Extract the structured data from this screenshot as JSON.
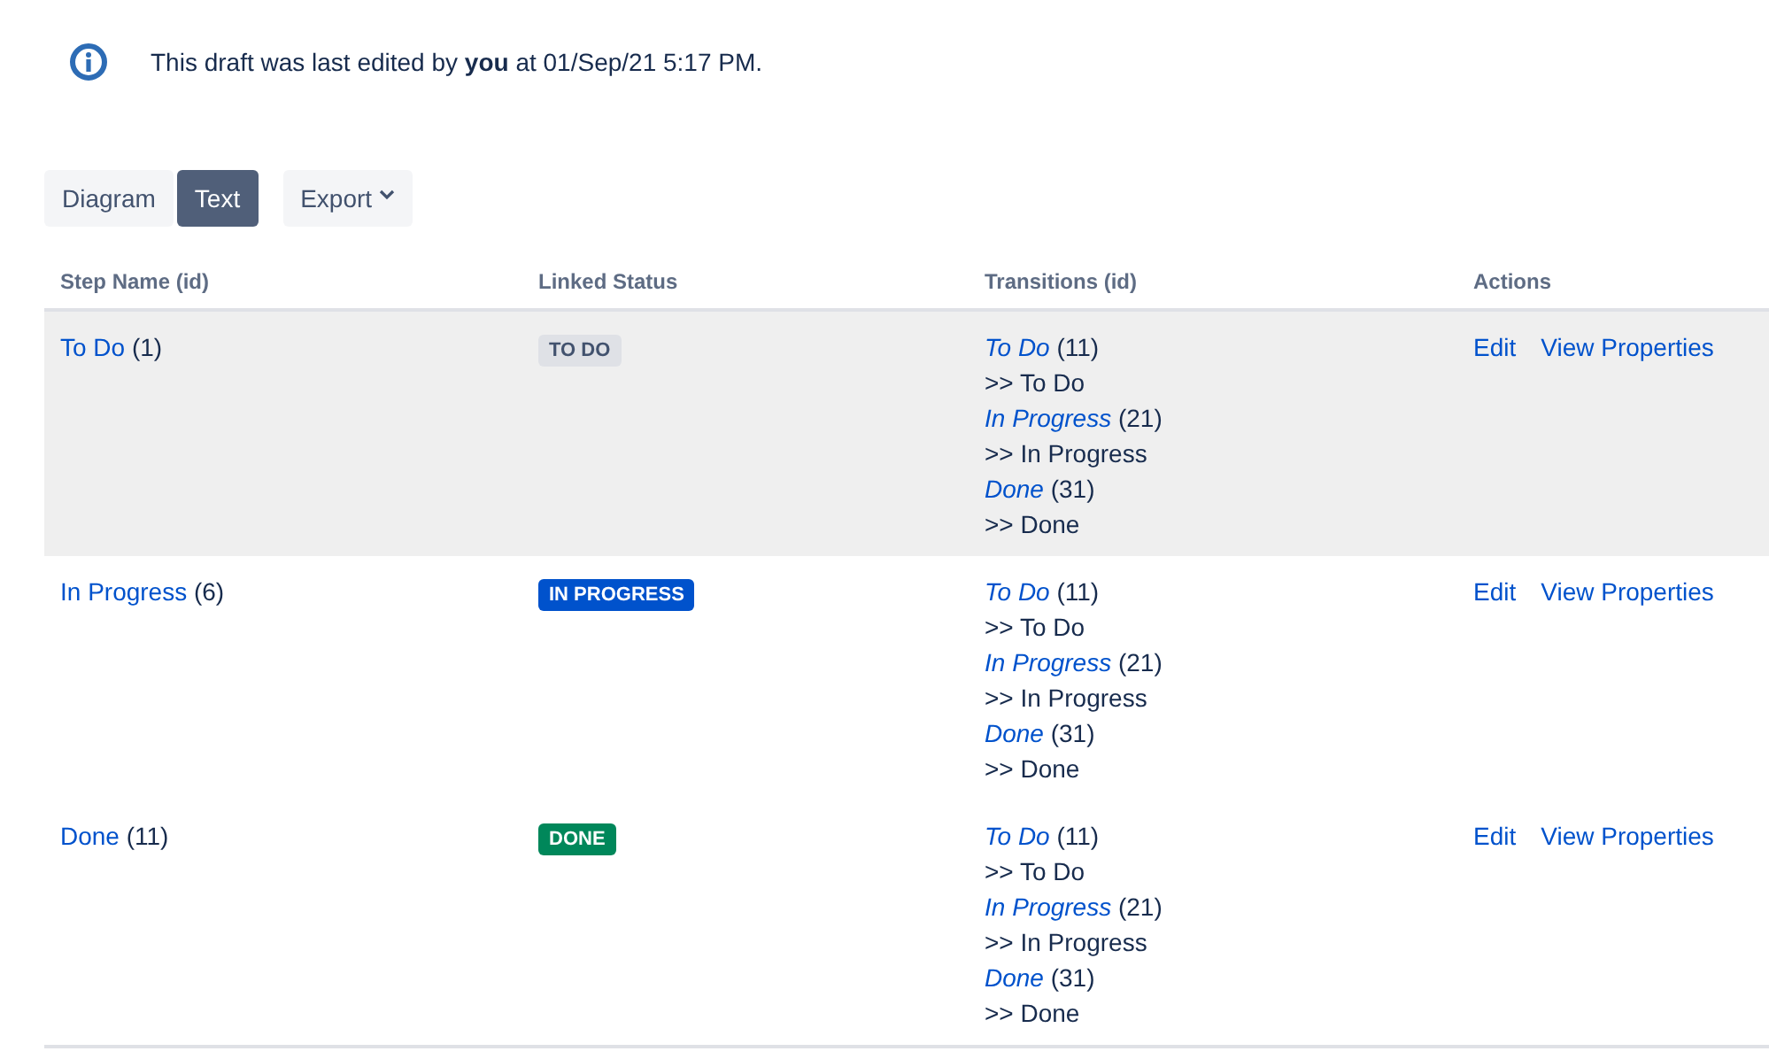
{
  "notice": {
    "text": "This draft was last edited by **you** at 01/Sep/21 5:17 PM."
  },
  "view_toggle": [
    {
      "label": "Diagram",
      "selected": false
    },
    {
      "label": "Text",
      "selected": true
    }
  ],
  "export_button": {
    "label": "Export"
  },
  "table": {
    "columns": [
      "Step Name (id)",
      "Linked Status",
      "Transitions (id)",
      "Actions"
    ],
    "rows": [
      {
        "selected": true,
        "step": "To Do",
        "step_id": "(1)",
        "status": {
          "label": "TO DO",
          "kind": "default"
        },
        "transitions": [
          {
            "name": "To Do",
            "id": "(11)",
            "target": ">> To Do"
          },
          {
            "name": "In Progress",
            "id": "(21)",
            "target": ">> In Progress"
          },
          {
            "name": "Done",
            "id": "(31)",
            "target": ">> Done"
          }
        ],
        "actions": [
          "Edit",
          "View Properties"
        ]
      },
      {
        "selected": false,
        "step": "In Progress",
        "step_id": "(6)",
        "status": {
          "label": "IN PROGRESS",
          "kind": "inprogress"
        },
        "transitions": [
          {
            "name": "To Do",
            "id": "(11)",
            "target": ">> To Do"
          },
          {
            "name": "In Progress",
            "id": "(21)",
            "target": ">> In Progress"
          },
          {
            "name": "Done",
            "id": "(31)",
            "target": ">> Done"
          }
        ],
        "actions": [
          "Edit",
          "View Properties"
        ]
      },
      {
        "selected": false,
        "step": "Done",
        "step_id": "(11)",
        "status": {
          "label": "DONE",
          "kind": "success"
        },
        "transitions": [
          {
            "name": "To Do",
            "id": "(11)",
            "target": ">> To Do"
          },
          {
            "name": "In Progress",
            "id": "(21)",
            "target": ">> In Progress"
          },
          {
            "name": "Done",
            "id": "(31)",
            "target": ">> Done"
          }
        ],
        "actions": [
          "Edit",
          "View Properties"
        ]
      }
    ]
  }
}
